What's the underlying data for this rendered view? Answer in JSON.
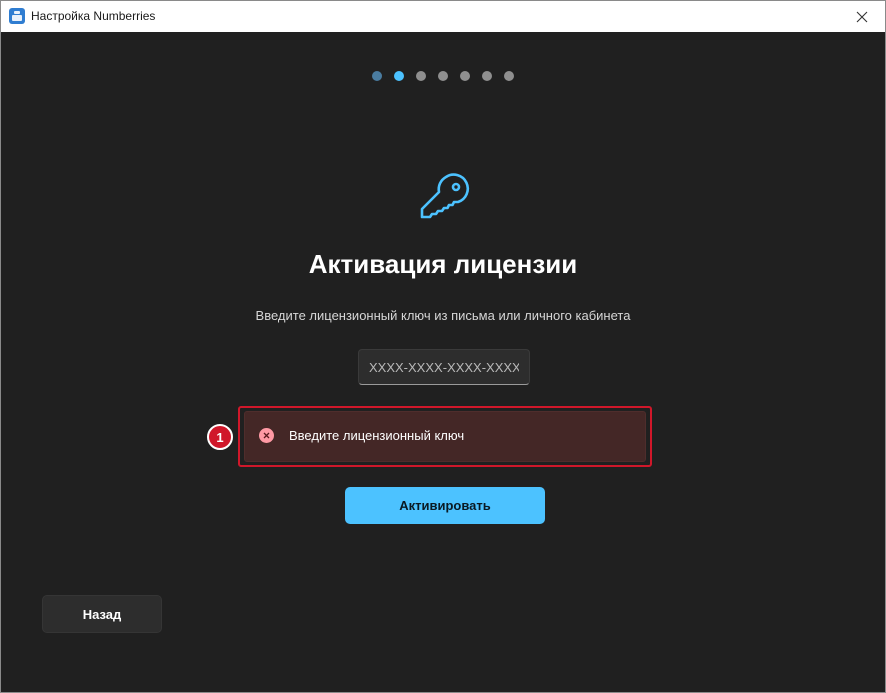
{
  "window": {
    "title": "Настройка Numberries",
    "icon": "app-icon",
    "close_icon": "close-icon"
  },
  "wizard": {
    "total_steps": 7,
    "current_step": 2,
    "colors": {
      "done": "#4a7ca0",
      "active": "#4cc2ff",
      "pending": "#8f8f8f"
    }
  },
  "activation": {
    "icon": "key-icon",
    "heading": "Активация лицензии",
    "subtitle": "Введите лицензионный ключ из письма или личного кабинета",
    "key_input": {
      "value": "",
      "placeholder": "XXXX-XXXX-XXXX-XXXX"
    },
    "error": {
      "icon": "error-icon",
      "message": "Введите лицензионный ключ"
    },
    "activate_label": "Активировать"
  },
  "navigation": {
    "back_label": "Назад"
  },
  "annotation": {
    "number": "1",
    "color": "#d0172a"
  },
  "colors": {
    "accent": "#4cc2ff",
    "background": "#202020",
    "error_bg": "#442726",
    "error_icon": "#ff99a4"
  }
}
